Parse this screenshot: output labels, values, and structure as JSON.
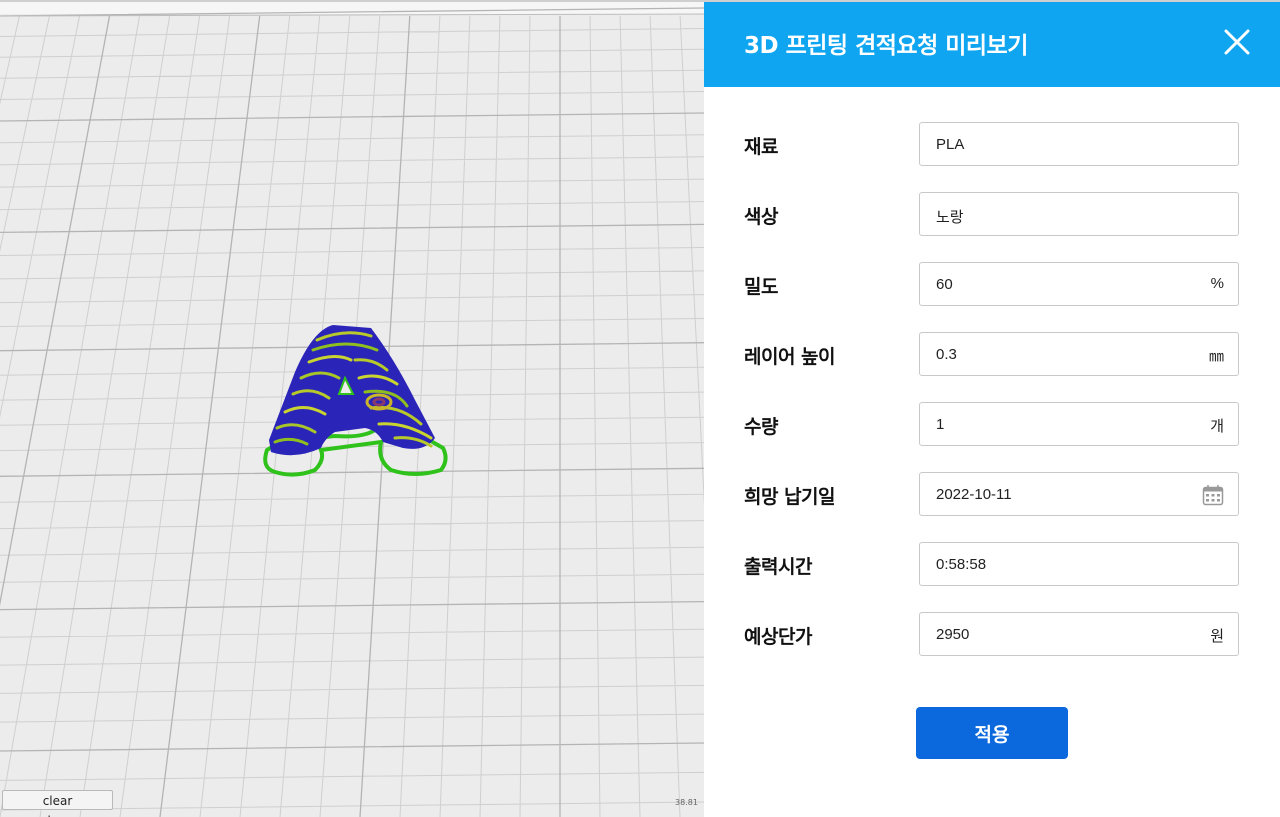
{
  "viewport": {
    "clear_button_label": "clear workspace",
    "fps_readout": "38.81"
  },
  "panel": {
    "title": "3D 프린팅 견적요청 미리보기",
    "header_color": "#0fa5f0",
    "close_icon": "close-icon",
    "fields": [
      {
        "label": "재료",
        "value": "PLA",
        "unit": ""
      },
      {
        "label": "색상",
        "value": "노랑",
        "unit": ""
      },
      {
        "label": "밀도",
        "value": "60",
        "unit": "%"
      },
      {
        "label": "레이어 높이",
        "value": "0.3",
        "unit": "㎜"
      },
      {
        "label": "수량",
        "value": "1",
        "unit": "개"
      },
      {
        "label": "희망 납기일",
        "value": "2022-10-11",
        "unit": "",
        "icon": "calendar-icon"
      },
      {
        "label": "출력시간",
        "value": "0:58:58",
        "unit": ""
      },
      {
        "label": "예상단가",
        "value": "2950",
        "unit": "원"
      }
    ],
    "apply_label": "적용",
    "apply_color": "#0b69dd"
  }
}
